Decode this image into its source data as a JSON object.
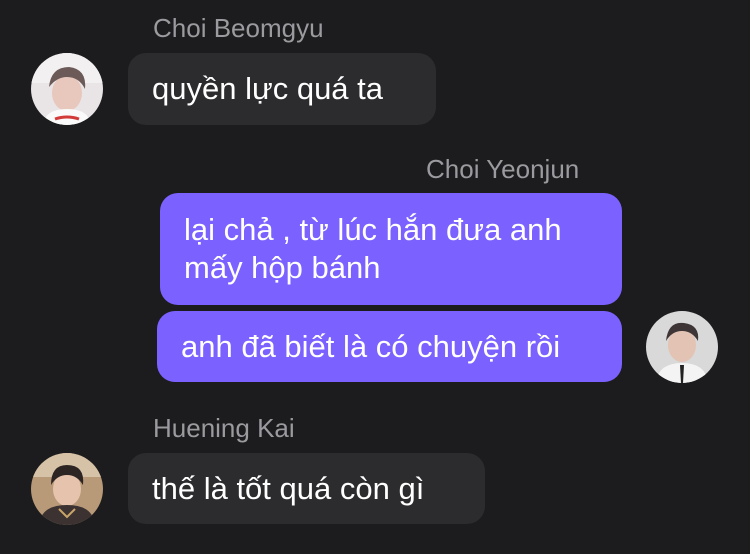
{
  "messages": [
    {
      "sender": "Choi Beomgyu",
      "direction": "incoming",
      "avatar_icon": "profile-photo-beomgyu",
      "bubbles": [
        "quyền lực quá ta"
      ]
    },
    {
      "sender": "Choi Yeonjun",
      "direction": "outgoing",
      "avatar_icon": "profile-photo-yeonjun",
      "bubbles": [
        [
          "lại chả , từ lúc hắn đưa anh",
          "mấy hộp bánh"
        ],
        "anh đã biết là có chuyện rồi"
      ]
    },
    {
      "sender": "Huening Kai",
      "direction": "incoming",
      "avatar_icon": "profile-photo-hueningkai",
      "bubbles": [
        "thế là tốt quá còn gì"
      ]
    }
  ],
  "colors": {
    "background": "#1c1c1e",
    "incoming_bubble": "#2c2c2e",
    "outgoing_bubble": "#7b61ff",
    "sender_name": "#9a9a9f",
    "message_text": "#ffffff"
  }
}
